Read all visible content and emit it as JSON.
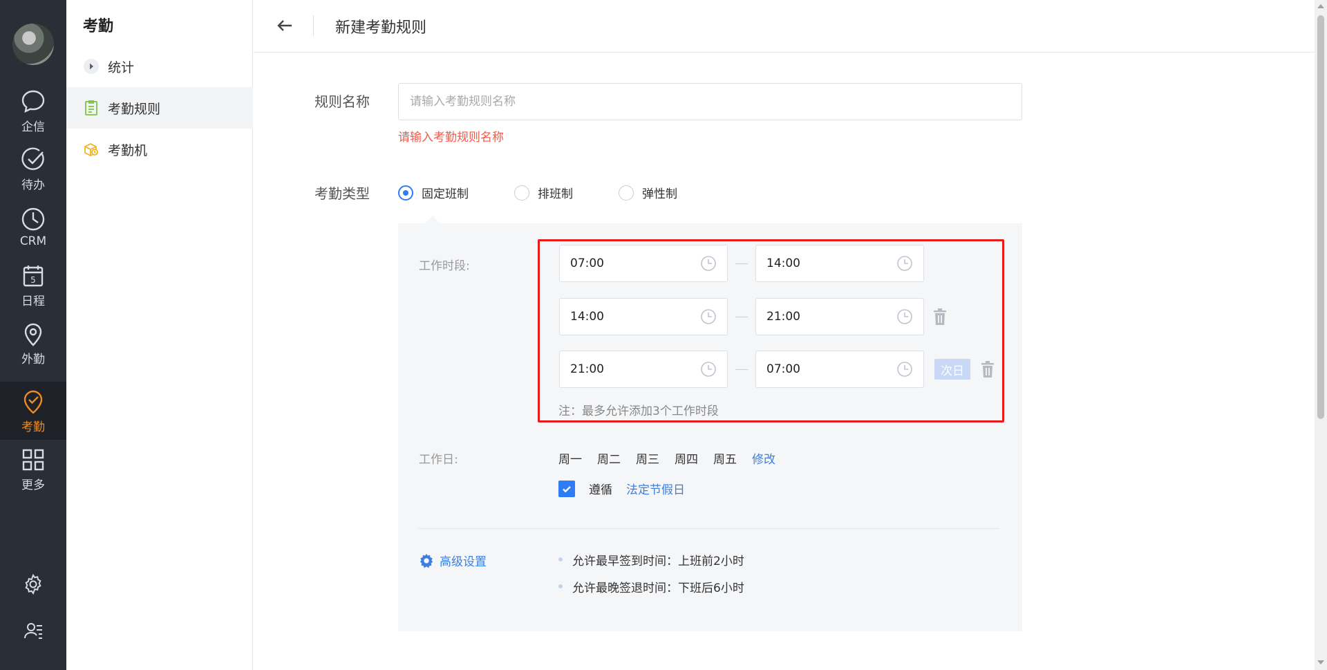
{
  "rail": {
    "items": [
      {
        "label": "企信",
        "icon": "chat-icon"
      },
      {
        "label": "待办",
        "icon": "check-circle-icon"
      },
      {
        "label": "CRM",
        "icon": "clock-icon"
      },
      {
        "label": "日程",
        "icon": "calendar-icon",
        "day": "5"
      },
      {
        "label": "外勤",
        "icon": "location-pin-icon"
      },
      {
        "label": "考勤",
        "icon": "attendance-pin-icon"
      },
      {
        "label": "更多",
        "icon": "grid-icon"
      }
    ],
    "active_color": "#f08c1f"
  },
  "submenu": {
    "title": "考勤",
    "items": [
      {
        "label": "统计",
        "icon": "play-circle-icon"
      },
      {
        "label": "考勤规则",
        "icon": "clipboard-icon"
      },
      {
        "label": "考勤机",
        "icon": "machine-icon"
      }
    ]
  },
  "header": {
    "title": "新建考勤规则"
  },
  "form": {
    "name_label": "规则名称",
    "name_placeholder": "请输入考勤规则名称",
    "name_error": "请输入考勤规则名称",
    "type_label": "考勤类型",
    "types": [
      "固定班制",
      "排班制",
      "弹性制"
    ],
    "selected_type": "固定班制",
    "work_period_label": "工作时段:",
    "periods": [
      {
        "start": "07:00",
        "end": "14:00"
      },
      {
        "start": "14:00",
        "end": "21:00"
      },
      {
        "start": "21:00",
        "end": "07:00",
        "next_day": "次日"
      }
    ],
    "period_note": "注：最多允许添加3个工作时段",
    "workday_label": "工作日:",
    "workdays": [
      "周一",
      "周二",
      "周三",
      "周四",
      "周五"
    ],
    "workday_edit": "修改",
    "follow_label": "遵循",
    "holiday_link": "法定节假日",
    "advanced_label": "高级设置",
    "advanced_items": [
      "允许最早签到时间：上班前2小时",
      "允许最晚签退时间：下班后6小时"
    ]
  },
  "colors": {
    "primary": "#2f7cf6",
    "error": "#f05a4a",
    "highlight_border": "#e51c1c"
  }
}
